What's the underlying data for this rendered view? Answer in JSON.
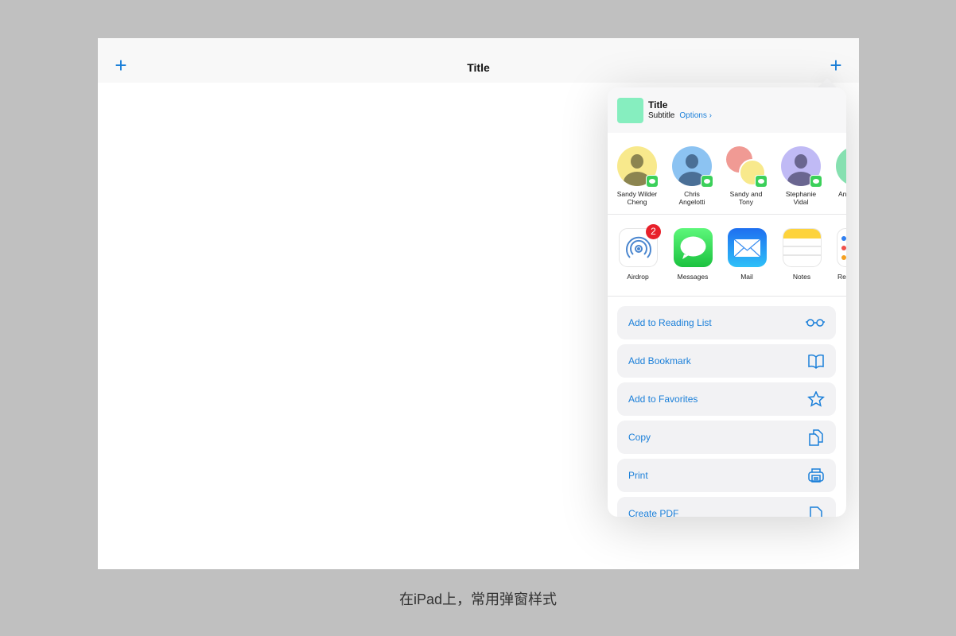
{
  "nav": {
    "title": "Title",
    "left_icon": "plus-icon",
    "right_icon": "plus-icon"
  },
  "popover": {
    "header": {
      "title": "Title",
      "subtitle": "Subtitle",
      "options": "Options ›"
    },
    "contacts": [
      {
        "line1": "Sandy Wilder",
        "line2": "Cheng",
        "color": "#f8e98c"
      },
      {
        "line1": "Chris",
        "line2": "Angelotti",
        "color": "#8cc3f2"
      },
      {
        "line1": "Sandy and",
        "line2": "Tony",
        "color": "#f8e98c"
      },
      {
        "line1": "Stephanie",
        "line2": "Vidal",
        "color": "#c0baf5"
      },
      {
        "line1": "An",
        "line2": "",
        "color": "#86e0b0"
      }
    ],
    "apps": [
      {
        "label": "Airdrop",
        "badge": "2"
      },
      {
        "label": "Messages"
      },
      {
        "label": "Mail"
      },
      {
        "label": "Notes"
      },
      {
        "label": "Re"
      }
    ],
    "actions": [
      {
        "label": "Add to Reading List",
        "icon": "glasses-icon"
      },
      {
        "label": "Add Bookmark",
        "icon": "book-icon"
      },
      {
        "label": "Add to Favorites",
        "icon": "star-icon"
      },
      {
        "label": "Copy",
        "icon": "copy-icon"
      },
      {
        "label": "Print",
        "icon": "printer-icon"
      },
      {
        "label": "Create PDF",
        "icon": "document-icon"
      }
    ]
  },
  "caption": "在iPad上，常用弹窗样式",
  "colors": {
    "accent": "#1a7fd9",
    "background": "#c0c0c0"
  }
}
